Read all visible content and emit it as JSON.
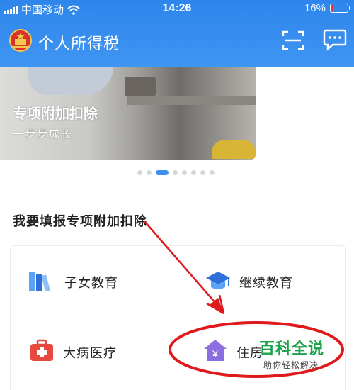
{
  "status_bar": {
    "carrier": "中国移动",
    "time": "14:26",
    "battery_text": "16%",
    "battery_level": 0.16,
    "battery_color": "#e8392f"
  },
  "header": {
    "app_title": "个人所得税",
    "bg_color": "#3390ef",
    "emblem_icon": "national-emblem-icon",
    "scan_icon": "scan-icon",
    "message_icon": "message-icon"
  },
  "banner": {
    "title": "专项附加扣除",
    "subtitle": "一步步成长",
    "page_count": 8,
    "active_index": 2,
    "accent": "#3d8ff0"
  },
  "section": {
    "title": "我要填报专项附加扣除",
    "items": [
      {
        "label": "子女教育",
        "icon": "books-icon"
      },
      {
        "label": "继续教育",
        "icon": "graduation-cap-icon"
      },
      {
        "label": "大病医疗",
        "icon": "medical-kit-icon"
      },
      {
        "label": "住房贷款利息",
        "icon": "house-yuan-icon"
      }
    ],
    "partial_label": "住房"
  },
  "watermark": {
    "title": "百科全说",
    "subtitle": "助你轻松解决"
  }
}
